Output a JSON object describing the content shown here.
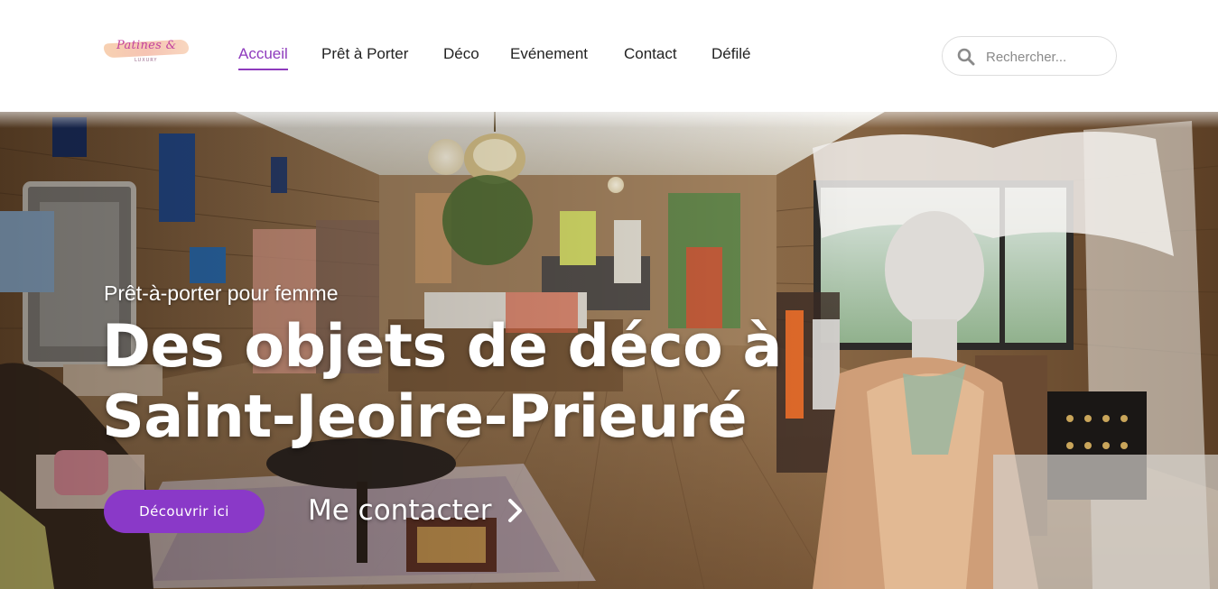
{
  "header": {
    "logo": {
      "text": "Patines &",
      "subtext": "LUXURY"
    },
    "nav": [
      {
        "label": "Accueil",
        "active": true
      },
      {
        "label": "Prêt à Porter",
        "active": false
      },
      {
        "label": "Déco",
        "active": false
      },
      {
        "label": "Evénement",
        "active": false
      },
      {
        "label": "Contact",
        "active": false
      },
      {
        "label": "Défilé",
        "active": false
      }
    ],
    "search": {
      "placeholder": "Rechercher...",
      "icon": "search-icon"
    }
  },
  "hero": {
    "kicker": "Prêt-à-porter pour femme",
    "title_line1": "Des objets de déco à",
    "title_line2": "Saint-Jeoire-Prieuré",
    "cta_primary": "Découvrir ici",
    "cta_secondary": "Me contacter",
    "cta_secondary_icon": "chevron-right-icon"
  },
  "colors": {
    "accent": "#8a39c8",
    "nav_active": "#8e3bbd",
    "logo_pink": "#c2419e",
    "text_dark": "#222222"
  }
}
